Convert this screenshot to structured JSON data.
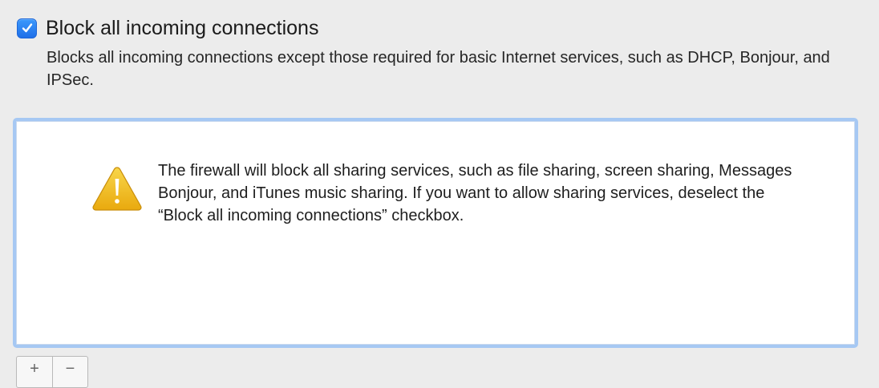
{
  "firewall": {
    "block_all_checkbox": {
      "label": "Block all incoming connections",
      "checked": true,
      "accent_color": "#2f86f6"
    },
    "description": "Blocks all incoming connections except those required for basic Internet services,  such as DHCP, Bonjour, and IPSec.",
    "alert": {
      "icon": "warning-icon",
      "message": "The firewall will block all sharing services, such as file sharing, screen sharing, Messages Bonjour, and iTunes music sharing. If you want to allow sharing services, deselect the “Block all incoming connections” checkbox."
    },
    "list_controls": {
      "add_label": "+",
      "remove_label": "−"
    }
  }
}
